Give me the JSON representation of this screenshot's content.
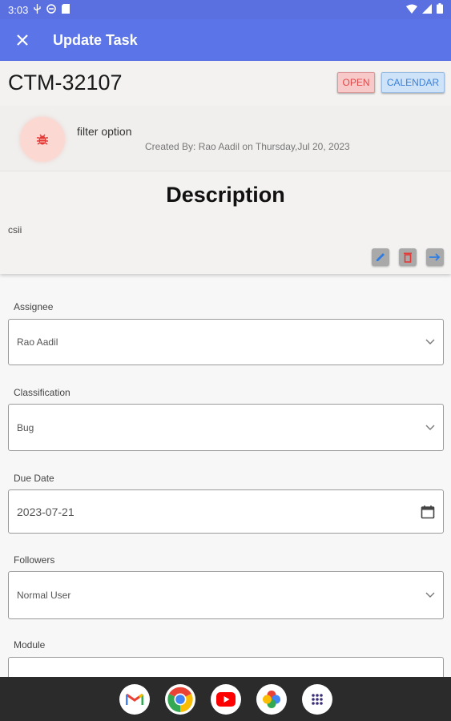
{
  "status_bar": {
    "time": "3:03"
  },
  "app_bar": {
    "title": "Update Task"
  },
  "task": {
    "id": "CTM-32107",
    "status_badge": "OPEN",
    "calendar_badge": "CALENDAR",
    "name": "filter option",
    "created_by": "Created By: Rao Aadil on Thursday,Jul 20, 2023",
    "description_heading": "Description",
    "description_body": "csii"
  },
  "form": {
    "assignee": {
      "label": "Assignee",
      "value": "Rao Aadil"
    },
    "classification": {
      "label": "Classification",
      "value": "Bug"
    },
    "due_date": {
      "label": "Due Date",
      "value": "2023-07-21"
    },
    "followers": {
      "label": "Followers",
      "value": "Normal User"
    },
    "module": {
      "label": "Module",
      "value": ""
    }
  },
  "colors": {
    "app_bar": "#5b74e8",
    "status_open": "#e04848",
    "calendar_blue": "#3c7fd6",
    "bug_red": "#e53935"
  },
  "icons": [
    "close-icon",
    "bug-icon",
    "edit-icon",
    "delete-icon",
    "arrow-right-icon",
    "chevron-down-icon",
    "calendar-icon",
    "gmail-icon",
    "chrome-icon",
    "youtube-icon",
    "photos-icon",
    "app-drawer-icon"
  ]
}
